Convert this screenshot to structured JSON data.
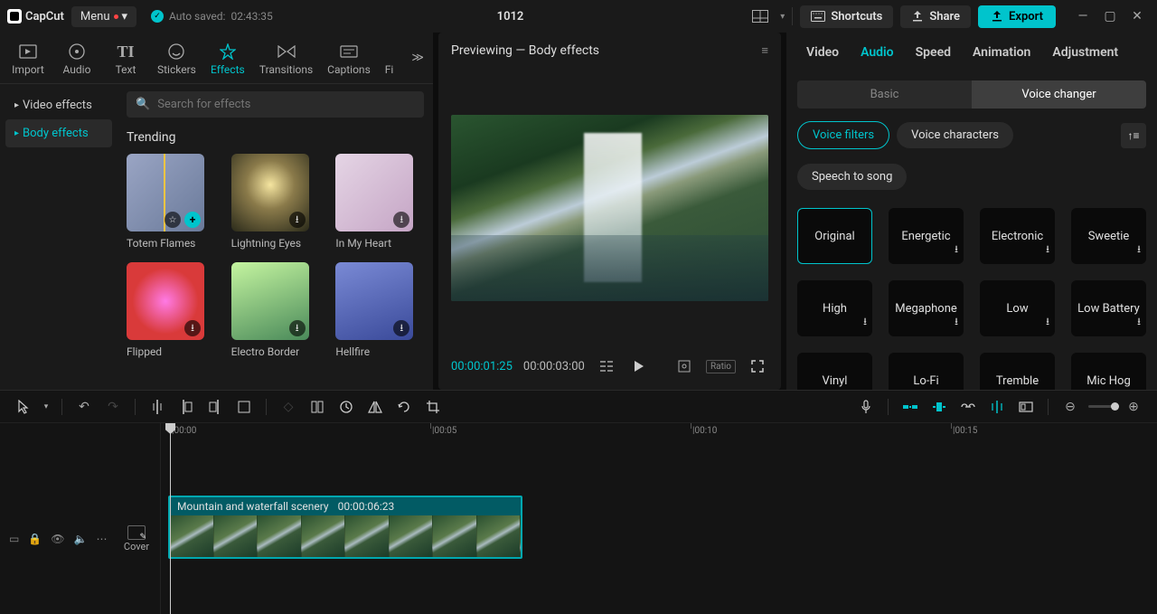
{
  "app": {
    "name": "CapCut",
    "menu_label": "Menu",
    "autosave_label": "Auto saved:",
    "autosave_time": "02:43:35",
    "project_title": "1012"
  },
  "titlebar": {
    "shortcuts": "Shortcuts",
    "share": "Share",
    "export": "Export"
  },
  "media_tabs": [
    "Import",
    "Audio",
    "Text",
    "Stickers",
    "Effects",
    "Transitions",
    "Captions",
    "Fi"
  ],
  "effects_sidebar": {
    "categories": [
      "Video effects",
      "Body effects"
    ]
  },
  "search": {
    "placeholder": "Search for effects"
  },
  "effects_section_title": "Trending",
  "effects": [
    {
      "name": "Totem Flames"
    },
    {
      "name": "Lightning Eyes"
    },
    {
      "name": "In My Heart"
    },
    {
      "name": "Flipped"
    },
    {
      "name": "Electro Border"
    },
    {
      "name": "Hellfire"
    }
  ],
  "preview": {
    "title": "Previewing — Body effects",
    "current_time": "00:00:01:25",
    "duration": "00:00:03:00",
    "ratio_label": "Ratio"
  },
  "inspector": {
    "tabs": [
      "Video",
      "Audio",
      "Speed",
      "Animation",
      "Adjustment"
    ],
    "active_tab": "Audio",
    "sub_tabs": [
      "Basic",
      "Voice changer"
    ],
    "active_sub": "Voice changer",
    "pills": [
      "Voice filters",
      "Voice characters",
      "Speech to song"
    ],
    "voices": [
      "Original",
      "Energetic",
      "Electronic",
      "Sweetie",
      "High",
      "Megaphone",
      "Low",
      "Low Battery",
      "Vinyl",
      "Lo-Fi",
      "Tremble",
      "Mic Hog"
    ]
  },
  "timeline": {
    "ruler": [
      "00:00",
      "00:05",
      "00:10",
      "00:15"
    ],
    "clip": {
      "name": "Mountain and waterfall scenery",
      "duration": "00:00:06:23"
    },
    "cover_label": "Cover"
  }
}
